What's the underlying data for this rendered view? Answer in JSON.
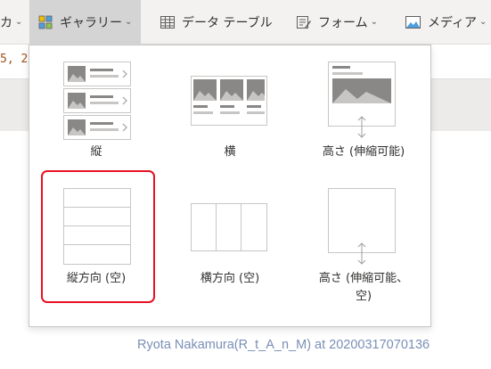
{
  "ribbon": {
    "items": [
      {
        "label": "カ",
        "icon": "none"
      },
      {
        "label": "ギャラリー",
        "icon": "gallery-icon"
      },
      {
        "label": "データ テーブル",
        "icon": "data-table-icon"
      },
      {
        "label": "フォーム",
        "icon": "form-icon"
      },
      {
        "label": "メディア",
        "icon": "media-icon"
      }
    ]
  },
  "formula": {
    "text": "5, 2"
  },
  "gallery_menu": {
    "tiles": [
      {
        "label": "縦"
      },
      {
        "label": "横"
      },
      {
        "label": "高さ (伸縮可能)"
      },
      {
        "label": "縦方向 (空)"
      },
      {
        "label": "横方向 (空)"
      },
      {
        "label_line1": "高さ (伸縮可能、",
        "label_line2": "空)"
      }
    ],
    "selected_index": 3
  },
  "colors": {
    "ribbon_bg": "#f3f2f1",
    "selected_tab_bg": "#d4d4d4",
    "highlight": "#e81123",
    "thumb_gray": "#8a8886"
  },
  "watermark": "Ryota Nakamura(R_t_A_n_M) at 20200317070136"
}
